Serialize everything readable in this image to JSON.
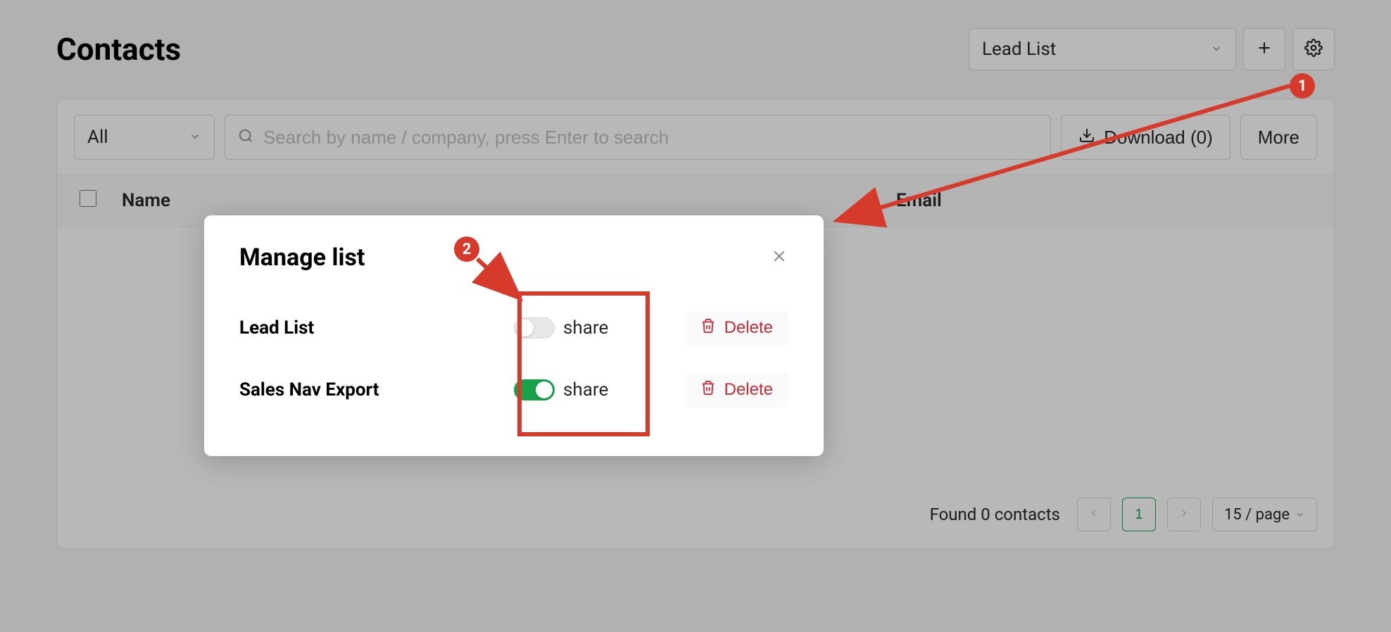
{
  "header": {
    "title": "Contacts",
    "list_select": "Lead List"
  },
  "toolbar": {
    "filter": "All",
    "search_placeholder": "Search by name / company, press Enter to search",
    "download_label": "Download (0)",
    "more_label": "More"
  },
  "table": {
    "columns": {
      "name": "Name",
      "email": "Email"
    }
  },
  "footer": {
    "found_text": "Found 0 contacts",
    "page": "1",
    "page_size": "15 / page"
  },
  "modal": {
    "title": "Manage list",
    "share_label": "share",
    "delete_label": "Delete",
    "rows": [
      {
        "name": "Lead List",
        "shared": false
      },
      {
        "name": "Sales Nav Export",
        "shared": true
      }
    ]
  },
  "annotations": {
    "badge1": "1",
    "badge2": "2"
  }
}
